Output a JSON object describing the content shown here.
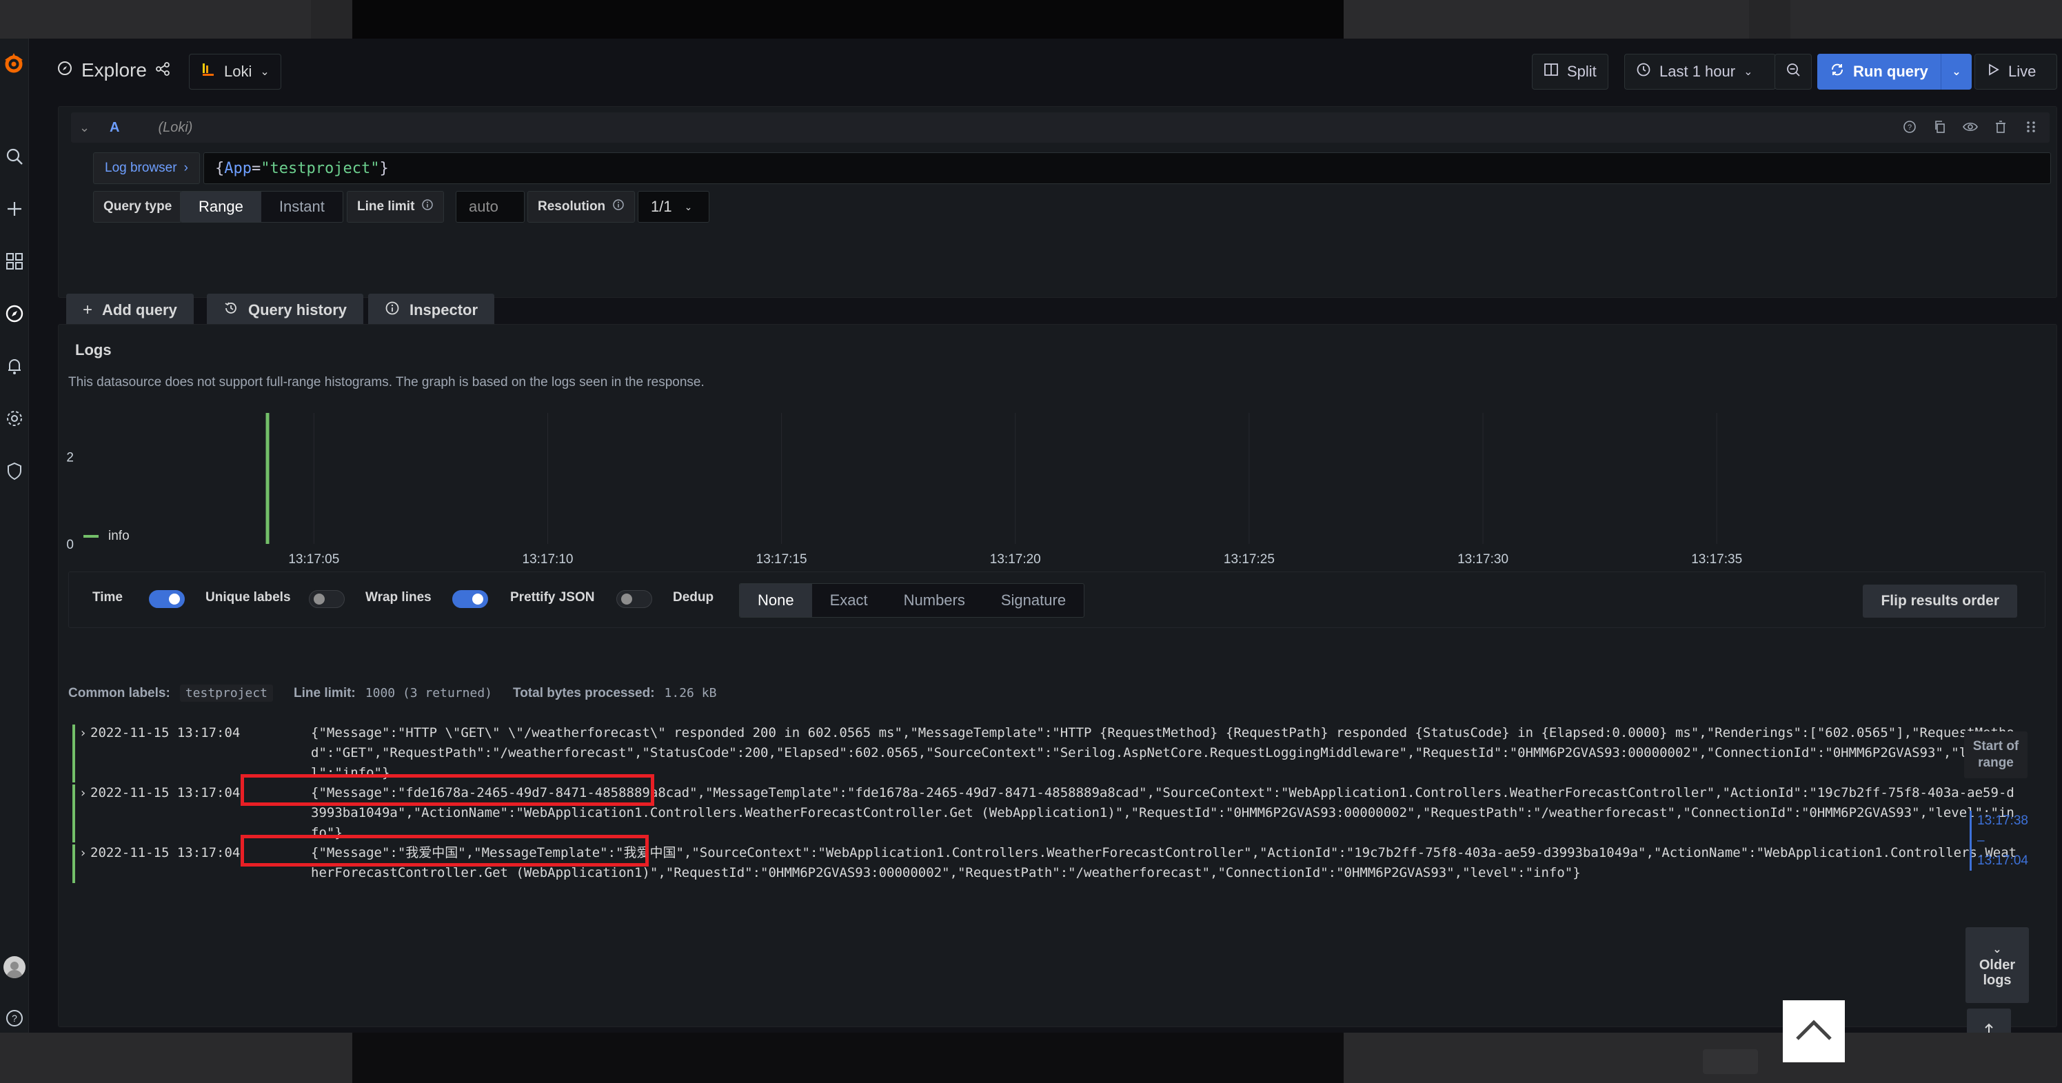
{
  "topbar": {
    "title": "Explore",
    "datasource": "Loki",
    "split_label": "Split",
    "time_range": "Last 1 hour",
    "run_query_label": "Run query",
    "live_label": "Live"
  },
  "query": {
    "ref_id": "A",
    "datasource_name": "(Loki)",
    "log_browser_label": "Log browser",
    "expression": {
      "open": "{",
      "key": "App",
      "eq": "=",
      "value": "\"testproject\"",
      "close": "}"
    },
    "query_type_label": "Query type",
    "query_type_options": [
      "Range",
      "Instant"
    ],
    "query_type_selected": "Range",
    "line_limit_label": "Line limit",
    "line_limit_placeholder": "auto",
    "resolution_label": "Resolution",
    "resolution_value": "1/1"
  },
  "query_actions": {
    "add_query": "Add query",
    "query_history": "Query history",
    "inspector": "Inspector"
  },
  "logs": {
    "title": "Logs",
    "description": "This datasource does not support full-range histograms. The graph is based on the logs seen in the response.",
    "legend": "info",
    "options": {
      "time": "Time",
      "unique_labels": "Unique labels",
      "wrap_lines": "Wrap lines",
      "prettify_json": "Prettify JSON",
      "dedup": "Dedup",
      "dedup_options": [
        "None",
        "Exact",
        "Numbers",
        "Signature"
      ],
      "dedup_selected": "None",
      "flip": "Flip results order"
    },
    "meta": {
      "common_labels_label": "Common labels:",
      "common_labels_value": "testproject",
      "line_limit_label": "Line limit:",
      "line_limit_value": "1000 (3 returned)",
      "bytes_label": "Total bytes processed:",
      "bytes_value": "1.26 kB"
    },
    "rows": [
      {
        "timestamp": "2022-11-15 13:17:04",
        "message": "{\"Message\":\"HTTP \\\"GET\\\" \\\"/weatherforecast\\\" responded 200 in 602.0565 ms\",\"MessageTemplate\":\"HTTP {RequestMethod} {RequestPath} responded {StatusCode} in {Elapsed:0.0000} ms\",\"Renderings\":[\"602.0565\"],\"RequestMethod\":\"GET\",\"RequestPath\":\"/weatherforecast\",\"StatusCode\":200,\"Elapsed\":602.0565,\"SourceContext\":\"Serilog.AspNetCore.RequestLoggingMiddleware\",\"RequestId\":\"0HMM6P2GVAS93:00000002\",\"ConnectionId\":\"0HMM6P2GVAS93\",\"level\":\"info\"}"
      },
      {
        "timestamp": "2022-11-15 13:17:04",
        "message": "{\"Message\":\"fde1678a-2465-49d7-8471-4858889a8cad\",\"MessageTemplate\":\"fde1678a-2465-49d7-8471-4858889a8cad\",\"SourceContext\":\"WebApplication1.Controllers.WeatherForecastController\",\"ActionId\":\"19c7b2ff-75f8-403a-ae59-d3993ba1049a\",\"ActionName\":\"WebApplication1.Controllers.WeatherForecastController.Get (WebApplication1)\",\"RequestId\":\"0HMM6P2GVAS93:00000002\",\"RequestPath\":\"/weatherforecast\",\"ConnectionId\":\"0HMM6P2GVAS93\",\"level\":\"info\"}"
      },
      {
        "timestamp": "2022-11-15 13:17:04",
        "message": "{\"Message\":\"我爱中国\",\"MessageTemplate\":\"我爱中国\",\"SourceContext\":\"WebApplication1.Controllers.WeatherForecastController\",\"ActionId\":\"19c7b2ff-75f8-403a-ae59-d3993ba1049a\",\"ActionName\":\"WebApplication1.Controllers.WeatherForecastController.Get (WebApplication1)\",\"RequestId\":\"0HMM6P2GVAS93:00000002\",\"RequestPath\":\"/weatherforecast\",\"ConnectionId\":\"0HMM6P2GVAS93\",\"level\":\"info\"}"
      }
    ],
    "range_panel": {
      "start_of_range": "Start of range",
      "range_from": "13:17:38",
      "range_sep": "–",
      "range_to": "13:17:04",
      "older_logs": "Older logs"
    }
  },
  "chart_data": {
    "type": "bar",
    "title": "",
    "x": [
      "13:17:05",
      "13:17:10",
      "13:17:15",
      "13:17:20",
      "13:17:25",
      "13:17:30",
      "13:17:35"
    ],
    "series": [
      {
        "name": "info",
        "points": [
          {
            "x": "13:17:04",
            "y": 3
          }
        ],
        "color": "#73bf69"
      }
    ],
    "y_ticks": [
      0,
      2
    ],
    "ylim": [
      0,
      3
    ],
    "grid": true,
    "legend_placement": "bottom-left"
  },
  "colors": {
    "accent": "#3d71d9",
    "info_level": "#73bf69",
    "highlight": "#e81f25",
    "grafana_logo": "#f46800"
  },
  "icons": {
    "nav": [
      "grafana-logo-icon",
      "search-icon",
      "plus-icon",
      "dashboards-icon",
      "explore-icon",
      "alerting-icon",
      "settings-icon",
      "shield-icon",
      "user-avatar-icon",
      "help-icon"
    ]
  }
}
